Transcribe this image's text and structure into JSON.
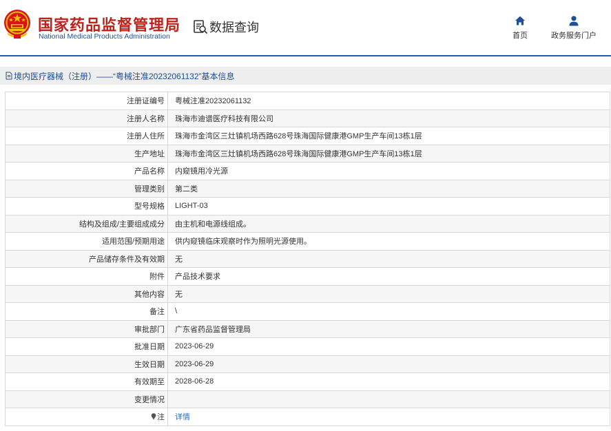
{
  "header": {
    "logo_cn": "国家药品监督管理局",
    "logo_en": "National Medical Products Administration",
    "query_label": "数据查询",
    "nav": [
      {
        "label": "首页",
        "icon": "home-icon"
      },
      {
        "label": "政务服务门户",
        "icon": "user-icon"
      }
    ]
  },
  "breadcrumb": {
    "text": "境内医疗器械（注册）——“粤械注准20232061132”基本信息",
    "icon": "document-icon"
  },
  "rows": [
    {
      "label": "注册证编号",
      "value": "粤械注准20232061132"
    },
    {
      "label": "注册人名称",
      "value": "珠海市迪谱医疗科技有限公司"
    },
    {
      "label": "注册人住所",
      "value": "珠海市金湾区三灶镇机场西路628号珠海国际健康港GMP生产车间13栋1层"
    },
    {
      "label": "生产地址",
      "value": "珠海市金湾区三灶镇机场西路628号珠海国际健康港GMP生产车间13栋1层"
    },
    {
      "label": "产品名称",
      "value": "内窥镜用冷光源"
    },
    {
      "label": "管理类别",
      "value": "第二类"
    },
    {
      "label": "型号规格",
      "value": "LIGHT-03"
    },
    {
      "label": "结构及组成/主要组成成分",
      "value": "由主机和电源线组成。"
    },
    {
      "label": "适用范围/预期用途",
      "value": "供内窥镜临床观察时作为照明光源使用。"
    },
    {
      "label": "产品储存条件及有效期",
      "value": "无"
    },
    {
      "label": "附件",
      "value": "产品技术要求"
    },
    {
      "label": "其他内容",
      "value": "无"
    },
    {
      "label": "备注",
      "value": "\\"
    },
    {
      "label": "审批部门",
      "value": "广东省药品监督管理局"
    },
    {
      "label": "批准日期",
      "value": "2023-06-29"
    },
    {
      "label": "生效日期",
      "value": "2023-06-29"
    },
    {
      "label": "有效期至",
      "value": "2028-06-28"
    },
    {
      "label": "变更情况",
      "value": ""
    }
  ],
  "note_row": {
    "label": "注",
    "value": "详情",
    "icon": "pin-icon"
  },
  "colors": {
    "brand_red": "#c0211b",
    "brand_blue": "#1f4f97",
    "link": "#2a6fc4"
  }
}
